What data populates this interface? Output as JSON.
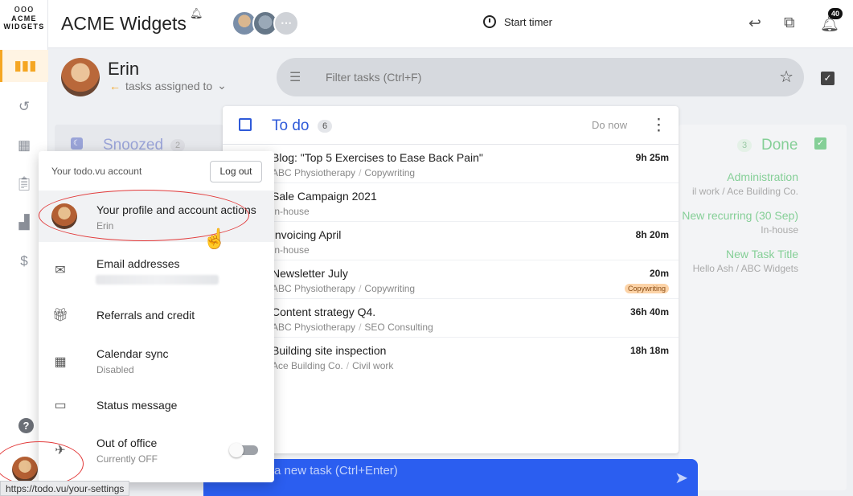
{
  "app": {
    "logo_marks": "ooo",
    "logo_line1": "ACME",
    "logo_line2": "WIDGETS",
    "title": "ACME Widgets"
  },
  "topbar": {
    "timer_label": "Start timer",
    "notifications_count": "40",
    "team_more": "⋯"
  },
  "header": {
    "user_name": "Erin",
    "assign_label": "tasks assigned to",
    "filter_placeholder": "Filter tasks (Ctrl+F)"
  },
  "snoozed": {
    "title": "Snoozed",
    "count": "2"
  },
  "todo": {
    "title": "To do",
    "count": "6",
    "do_now": "Do now",
    "tasks": [
      {
        "title": "Blog: \"Top 5 Exercises to Ease Back Pain\"",
        "client": "ABC Physiotherapy",
        "project": "Copywriting",
        "time": "9h 25m",
        "tag": ""
      },
      {
        "title": "Sale Campaign 2021",
        "client": "In-house",
        "project": "",
        "time": "",
        "tag": ""
      },
      {
        "title": "Invoicing April",
        "client": "In-house",
        "project": "",
        "time": "8h 20m",
        "tag": ""
      },
      {
        "title": "Newsletter July",
        "client": "ABC Physiotherapy",
        "project": "Copywriting",
        "time": "20m",
        "tag": "Copywriting"
      },
      {
        "title": "Content strategy Q4.",
        "client": "ABC Physiotherapy",
        "project": "SEO Consulting",
        "time": "36h 40m",
        "tag": ""
      },
      {
        "title": "Building site inspection",
        "client": "Ace Building Co.",
        "project": "Civil work",
        "time": "18h 18m",
        "tag": ""
      }
    ]
  },
  "done": {
    "title": "Done",
    "count": "3",
    "items": [
      {
        "title": "Administration",
        "sub": "il work / Ace Building Co."
      },
      {
        "title": "New recurring (30 Sep)",
        "sub": "In-house"
      },
      {
        "title": "New Task Title",
        "sub": "Hello Ash / ABC Widgets"
      }
    ]
  },
  "new_task": {
    "placeholder": "a new task (Ctrl+Enter)"
  },
  "account_menu": {
    "heading": "Your todo.vu account",
    "logout_label": "Log out",
    "items": [
      {
        "title": "Your profile and account actions",
        "sub": "Erin",
        "icon": "avatar"
      },
      {
        "title": "Email addresses",
        "sub": "",
        "icon": "mail-icon"
      },
      {
        "title": "Referrals and credit",
        "sub": "",
        "icon": "gift-icon"
      },
      {
        "title": "Calendar sync",
        "sub": "Disabled",
        "icon": "calendar-icon"
      },
      {
        "title": "Status message",
        "sub": "",
        "icon": "message-icon"
      },
      {
        "title": "Out of office",
        "sub": "Currently OFF",
        "icon": "airplane-icon"
      }
    ],
    "out_of_office_enabled": false
  },
  "status_url": "https://todo.vu/your-settings",
  "colors": {
    "accent_orange": "#f5a623",
    "todo_blue": "#2f5ad9",
    "done_green": "#85cf97",
    "new_task_blue": "#2b5ef0",
    "annotation_red": "#e23a3a"
  }
}
